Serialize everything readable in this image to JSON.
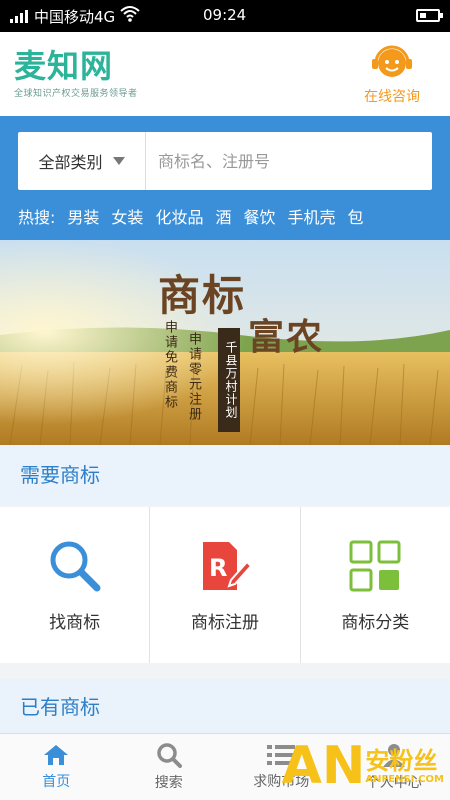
{
  "status_bar": {
    "carrier": "中国移动4G",
    "time": "09:24",
    "battery_level": 0.35
  },
  "header": {
    "logo_text": "麦知网",
    "logo_slogan": "全球知识产权交易服务领导者",
    "consult_label": "在线咨询",
    "consult_icon": "headset-avatar-icon"
  },
  "search": {
    "category_label": "全部类别",
    "placeholder": "商标名、注册号",
    "hot_label": "热搜:",
    "hot_items": [
      "男装",
      "女装",
      "化妆品",
      "酒",
      "餐饮",
      "手机壳",
      "包"
    ]
  },
  "banner": {
    "title": "商标",
    "subtitle": "富农",
    "vertical_1": "申请免费商标",
    "vertical_2": "申请零元注册",
    "tag": "千县万村计划"
  },
  "section_need": {
    "title": "需要商标",
    "items": [
      {
        "label": "找商标",
        "icon": "magnifier-icon"
      },
      {
        "label": "商标注册",
        "icon": "registration-document-icon"
      },
      {
        "label": "商标分类",
        "icon": "category-grid-icon"
      }
    ]
  },
  "section_have": {
    "title": "已有商标"
  },
  "tabbar": {
    "items": [
      {
        "label": "首页",
        "icon": "home-icon",
        "active": true
      },
      {
        "label": "搜索",
        "icon": "search-icon",
        "active": false
      },
      {
        "label": "求购市场",
        "icon": "list-icon",
        "active": false
      },
      {
        "label": "个人中心",
        "icon": "user-icon",
        "active": false
      }
    ]
  },
  "watermark": {
    "logo": "AN",
    "text": "安粉丝",
    "url": "ANFENSI.COM"
  },
  "colors": {
    "brand_blue": "#3a8fd8",
    "logo_teal": "#2bb49a",
    "consult_orange": "#f39a1c",
    "registration_red": "#e8453c",
    "category_green": "#7cbf3a"
  }
}
